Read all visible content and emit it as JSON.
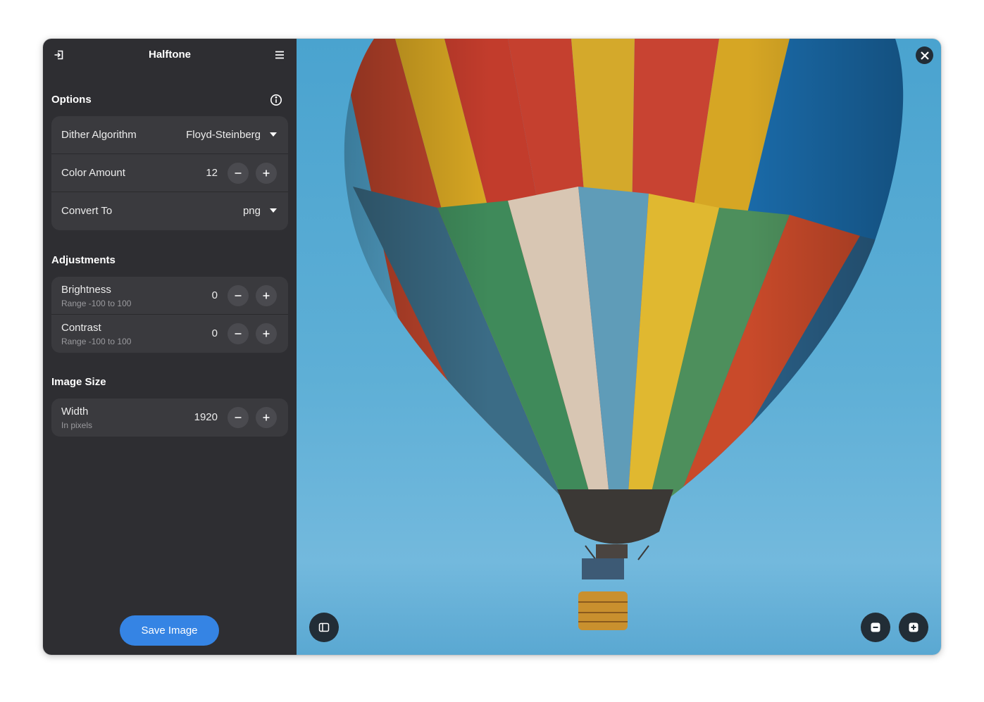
{
  "window": {
    "title": "Halftone"
  },
  "options": {
    "title": "Options",
    "dither": {
      "label": "Dither Algorithm",
      "value": "Floyd-Steinberg"
    },
    "colors": {
      "label": "Color Amount",
      "value": "12"
    },
    "convert": {
      "label": "Convert To",
      "value": "png"
    }
  },
  "adjustments": {
    "title": "Adjustments",
    "brightness": {
      "label": "Brightness",
      "subtitle": "Range -100 to 100",
      "value": "0"
    },
    "contrast": {
      "label": "Contrast",
      "subtitle": "Range -100 to 100",
      "value": "0"
    }
  },
  "image_size": {
    "title": "Image Size",
    "width": {
      "label": "Width",
      "subtitle": "In pixels",
      "value": "1920"
    }
  },
  "save": {
    "label": "Save Image"
  },
  "icons": {
    "open": "open-file-icon",
    "menu": "hamburger-menu-icon",
    "info": "info-icon",
    "close": "close-icon",
    "sidebar": "sidebar-toggle-icon",
    "zoom_out": "zoom-out-icon",
    "zoom_in": "zoom-in-icon"
  },
  "colors": {
    "accent": "#3584e4",
    "sidebar_bg": "#2e2e32",
    "row_bg": "#3a3a3e",
    "overlay_btn": "#222d36"
  }
}
